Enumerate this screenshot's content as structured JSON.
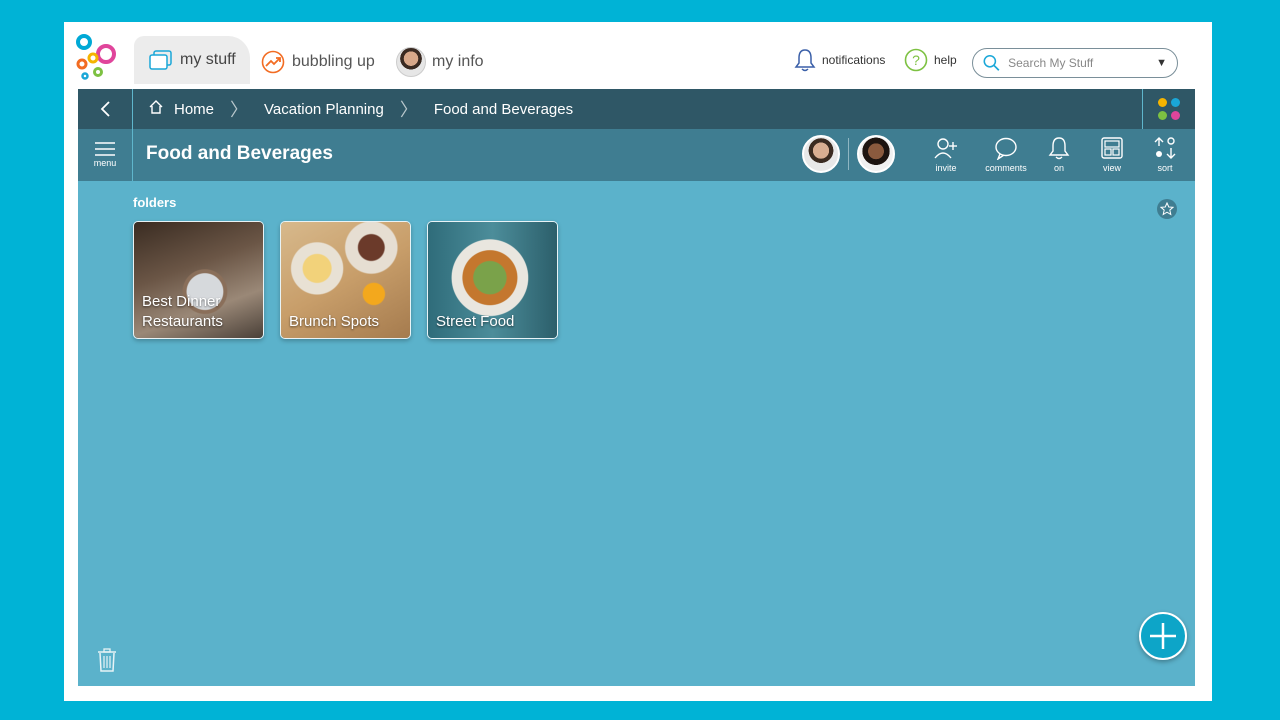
{
  "nav": {
    "tabs": [
      {
        "label": "my stuff",
        "icon": "folders-icon"
      },
      {
        "label": "bubbling up",
        "icon": "trending-icon"
      },
      {
        "label": "my info",
        "icon": "avatar"
      }
    ],
    "notifications_label": "notifications",
    "help_label": "help",
    "search_placeholder": "Search My Stuff"
  },
  "breadcrumb": {
    "items": [
      "Home",
      "Vacation Planning",
      "Food and Beverages"
    ]
  },
  "header": {
    "menu_label": "menu",
    "title": "Food and Beverages",
    "actions": [
      {
        "label": "invite",
        "icon": "invite-icon"
      },
      {
        "label": "comments",
        "icon": "comments-icon"
      },
      {
        "label": "on",
        "icon": "bell-icon"
      },
      {
        "label": "view",
        "icon": "view-icon"
      },
      {
        "label": "sort",
        "icon": "sort-icon"
      }
    ]
  },
  "content": {
    "section_label": "folders",
    "folders": [
      {
        "label": "Best Dinner Restaurants"
      },
      {
        "label": "Brunch Spots"
      },
      {
        "label": "Street Food"
      }
    ]
  },
  "colors": {
    "page_bg": "#00b3d6",
    "crumb_bar": "#2f5766",
    "header_bar": "#3f7d91",
    "content_bg": "#5bb2cb",
    "fab": "#0da5c8",
    "app_dots": [
      "#f5b400",
      "#1aa7d8",
      "#7dc142",
      "#e0459b"
    ]
  }
}
